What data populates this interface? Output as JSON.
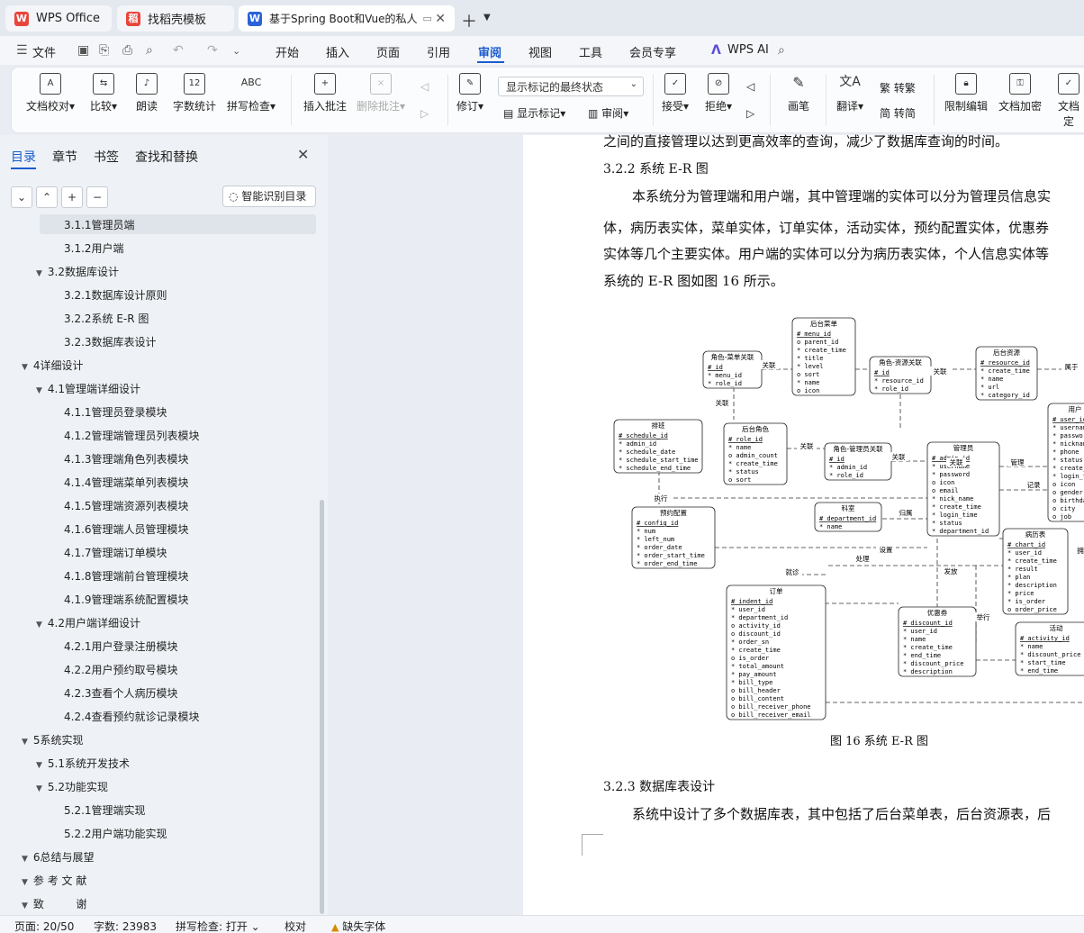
{
  "tabs": [
    {
      "label": "WPS Office",
      "logo": "W"
    },
    {
      "label": "找稻壳模板",
      "logo": "稻"
    },
    {
      "label": "基于Spring Boot和Vue的私人",
      "logo": "W"
    }
  ],
  "menu": {
    "file": "文件",
    "items": [
      "开始",
      "插入",
      "页面",
      "引用",
      "审阅",
      "视图",
      "工具",
      "会员专享"
    ],
    "wps_ai": "WPS AI"
  },
  "ribbon": {
    "doc_check": "文档校对",
    "compare": "比较",
    "read_aloud": "朗读",
    "word_count": "字数统计",
    "spell_check": "拼写检查",
    "insert_comment": "插入批注",
    "delete_comment": "删除批注",
    "revise": "修订",
    "markup_select": "显示标记的最终状态",
    "show_markup": "显示标记",
    "review": "审阅",
    "accept": "接受",
    "reject": "拒绝",
    "pen": "画笔",
    "translate": "翻译",
    "to_traditional": "转繁",
    "to_simplified": "转简",
    "restrict_edit": "限制编辑",
    "doc_encrypt": "文档加密",
    "doc_finalize": "文档定"
  },
  "sidebar": {
    "tabs": [
      "目录",
      "章节",
      "书签",
      "查找和替换"
    ],
    "smart_toc": "智能识别目录",
    "toc": [
      {
        "label": "3.1.1管理员端",
        "level": 3
      },
      {
        "label": "3.1.2用户端",
        "level": 3
      },
      {
        "label": "3.2数据库设计",
        "level": 2
      },
      {
        "label": "3.2.1数据库设计原则",
        "level": 3
      },
      {
        "label": "3.2.2系统 E-R 图",
        "level": 3
      },
      {
        "label": "3.2.3数据库表设计",
        "level": 3
      },
      {
        "label": "4详细设计",
        "level": 1
      },
      {
        "label": "4.1管理端详细设计",
        "level": 2
      },
      {
        "label": "4.1.1管理员登录模块",
        "level": 3
      },
      {
        "label": "4.1.2管理端管理员列表模块",
        "level": 3
      },
      {
        "label": "4.1.3管理端角色列表模块",
        "level": 3
      },
      {
        "label": "4.1.4管理端菜单列表模块",
        "level": 3
      },
      {
        "label": "4.1.5管理端资源列表模块",
        "level": 3
      },
      {
        "label": "4.1.6管理端人员管理模块",
        "level": 3
      },
      {
        "label": "4.1.7管理端订单模块",
        "level": 3
      },
      {
        "label": "4.1.8管理端前台管理模块",
        "level": 3
      },
      {
        "label": "4.1.9管理端系统配置模块",
        "level": 3
      },
      {
        "label": "4.2用户端详细设计",
        "level": 2
      },
      {
        "label": "4.2.1用户登录注册模块",
        "level": 3
      },
      {
        "label": "4.2.2用户预约取号模块",
        "level": 3
      },
      {
        "label": "4.2.3查看个人病历模块",
        "level": 3
      },
      {
        "label": "4.2.4查看预约就诊记录模块",
        "level": 3
      },
      {
        "label": "5系统实现",
        "level": 1
      },
      {
        "label": "5.1系统开发技术",
        "level": 2
      },
      {
        "label": "5.2功能实现",
        "level": 2
      },
      {
        "label": "5.2.1管理端实现",
        "level": 3
      },
      {
        "label": "5.2.2用户端功能实现",
        "level": 3
      },
      {
        "label": "6总结与展望",
        "level": 1
      },
      {
        "label": "参 考 文 献",
        "level": 1
      },
      {
        "label": "致 　 　 谢",
        "level": 1
      }
    ]
  },
  "document": {
    "line_top": "之间的直接管理以达到更高效率的查询，减少了数据库查询的时间。",
    "heading_322": "3.2.2 系统 E-R 图",
    "para1_l1": "本系统分为管理端和用户端，其中管理端的实体可以分为管理员信息实",
    "para1_l2": "体，病历表实体，菜单实体，订单实体，活动实体，预约配置实体，优惠券",
    "para1_l3": "实体等几个主要实体。用户端的实体可以分为病历表实体，个人信息实体等",
    "para1_l4": "系统的 E-R 图如图 16 所示。",
    "figure_caption": "图 16  系统 E-R 图",
    "heading_323": "3.2.3 数据库表设计",
    "para2": "系统中设计了多个数据库表，其中包括了后台菜单表，后台资源表，后"
  },
  "er": {
    "entities": [
      {
        "title": "后台菜单",
        "fields": [
          "# menu_id",
          "o parent_id",
          "* create_time",
          "* title",
          "* level",
          "o sort",
          "* name",
          "o icon"
        ]
      },
      {
        "title": "角色-菜单关联",
        "fields": [
          "# id",
          "* menu_id",
          "* role_id"
        ]
      },
      {
        "title": "角色-资源关联",
        "fields": [
          "# id",
          "* resource_id",
          "* role_id"
        ]
      },
      {
        "title": "后台资源",
        "fields": [
          "# resource_id",
          "* create_time",
          "* name",
          "* url",
          "* category_id"
        ]
      },
      {
        "title": "排班",
        "fields": [
          "# schedule_id",
          "* admin_id",
          "* schedule_date",
          "* schedule_start_time",
          "* schedule_end_time"
        ]
      },
      {
        "title": "后台角色",
        "fields": [
          "# role_id",
          "* name",
          "o admin_count",
          "* create_time",
          "* status",
          "o sort"
        ]
      },
      {
        "title": "角色-管理员关联",
        "fields": [
          "# id",
          "* admin_id",
          "* role_id"
        ]
      },
      {
        "title": "管理员",
        "fields": [
          "# admin_id",
          "* username",
          "* password",
          "o icon",
          "o email",
          "* nick_name",
          "* create_time",
          "* login_time",
          "* status",
          "* department_id"
        ]
      },
      {
        "title": "用户",
        "fields": [
          "# user_id",
          "* username",
          "* password",
          "* nickname",
          "* phone",
          "* status",
          "* create_time",
          "* login_time",
          "o icon",
          "o gender",
          "o birthday",
          "o city",
          "o job"
        ]
      },
      {
        "title": "预约配置",
        "fields": [
          "# config_id",
          "* num",
          "* left_num",
          "* order_date",
          "* order_start_time",
          "* order_end_time"
        ]
      },
      {
        "title": "科室",
        "fields": [
          "# department_id",
          "* name"
        ]
      },
      {
        "title": "病历表",
        "fields": [
          "# chart_id",
          "* user_id",
          "* create_time",
          "* result",
          "* plan",
          "* description",
          "* price",
          "* is_order",
          "o order_price"
        ]
      },
      {
        "title": "订单",
        "fields": [
          "# indent_id",
          "* user_id",
          "* department_id",
          "o activity_id",
          "o discount_id",
          "* order_sn",
          "* create_time",
          "o is_order",
          "* total_amount",
          "* pay_amount",
          "* bill_type",
          "o bill_header",
          "o bill_content",
          "o bill_receiver_phone",
          "o bill_receiver_email"
        ]
      },
      {
        "title": "优惠券",
        "fields": [
          "# discount_id",
          "* user_id",
          "* name",
          "* create_time",
          "* end_time",
          "* discount_price",
          "* description"
        ]
      },
      {
        "title": "活动",
        "fields": [
          "# activity_id",
          "* name",
          "* discount_price",
          "* start_time",
          "* end_time"
        ]
      }
    ],
    "relations": [
      "关联",
      "关联",
      "关联",
      "属于",
      "关联",
      "关联",
      "关联",
      "管理",
      "记录",
      "执行",
      "归属",
      "设置",
      "处理",
      "就诊",
      "发放",
      "举行",
      "拥"
    ]
  },
  "status": {
    "page": "页面: 20/50",
    "words": "字数: 23983",
    "spell": "拼写检查: 打开",
    "proof": "校对",
    "missing_font": "缺失字体"
  }
}
